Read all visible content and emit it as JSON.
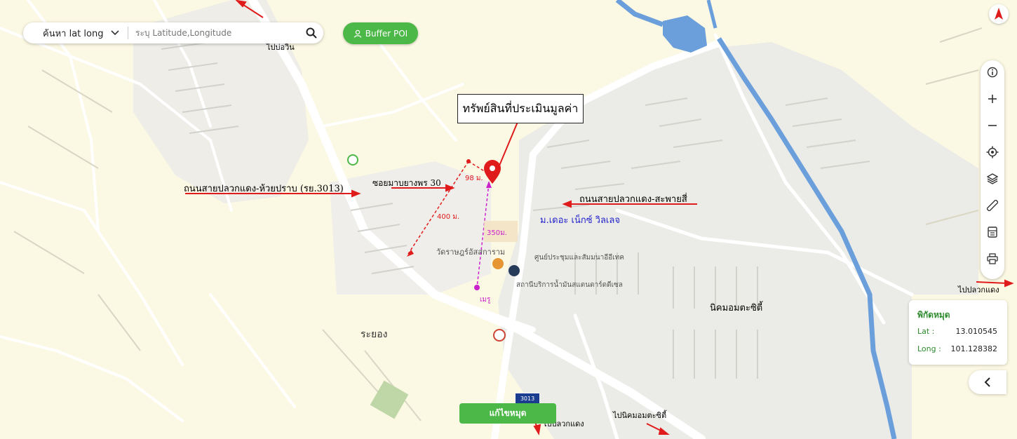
{
  "search": {
    "mode_label": "ค้นหา lat long",
    "placeholder": "ระบุ Latitude,Longitude"
  },
  "buffer_button": {
    "label": "Buffer POI"
  },
  "callout": {
    "text": "ทรัพย์สินที่ประเมินมูลค่า"
  },
  "map_labels": {
    "road_3013": "ถนนสายปลวกแดง-ห้วยปราบ (รย.3013)",
    "soi_30": "ซอยมาบยางพร 30",
    "road_saphai": "ถนนสายปลวกแดง-สะพายสี่",
    "village": "ม.เดอะ เน็กซ์ วิลเลจ",
    "temple": "วัดราษฎร์อัสสการาม",
    "center": "ศูนย์ประชุมและสัมมนาอีอีเทค",
    "gas": "สถานีบริการน้ำมันสแตนดาร์ดดีเซล",
    "estate": "นิคมอมตะซิตี้",
    "rayong": "ระยอง",
    "to_bo_win": "ไปบ่อวิน",
    "to_pluak_daeng_right": "ไปปลวกแดง",
    "to_pluak_daeng_bottom": "ไปปลวกแดง",
    "to_estate": "ไปนิคมอมตะซิตี้",
    "dist_98": "98 ม.",
    "dist_400": "400 ม.",
    "dist_350": "350ม.",
    "mega": "เมรู",
    "shield_num": "3013"
  },
  "coords": {
    "title": "พิกัดหมุด",
    "lat_label": "Lat :",
    "lat_value": "13.010545",
    "long_label": "Long :",
    "long_value": "101.128382"
  },
  "edit_button": {
    "label": "แก้ไขหมุด"
  },
  "colors": {
    "map_bg": "#fbf8e3",
    "urban": "#ebebe7",
    "green_button": "#4cb848",
    "arrow_red": "#e01b1b",
    "label_blue": "#2222cc",
    "river": "#6b9fdc",
    "measure_magenta": "#cc22cc"
  },
  "icons": [
    "search-icon",
    "chevron-down-icon",
    "user-icon",
    "info-icon",
    "zoom-in-icon",
    "zoom-out-icon",
    "locate-icon",
    "layers-icon",
    "ruler-icon",
    "calculator-icon",
    "print-icon",
    "compass-icon",
    "chevron-left-icon",
    "location-pin-icon"
  ]
}
